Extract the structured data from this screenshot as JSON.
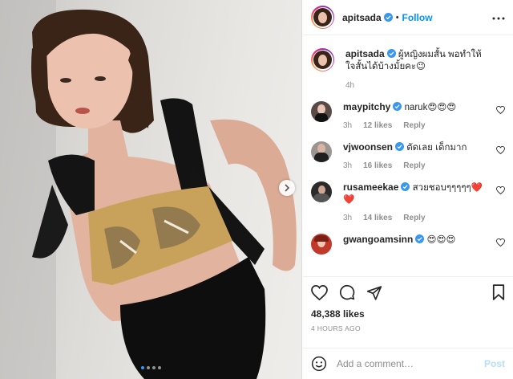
{
  "post": {
    "username": "apitsada",
    "follow_label": "Follow",
    "separator": "•",
    "caption": {
      "username": "apitsada",
      "text": "ผู้หญิงผมสั้น พอทำให้ใจสั้นได้บ้างมั้ยคะ😉",
      "time": "4h"
    },
    "comments": [
      {
        "username": "maypitchy",
        "text": "naruk😍😍😍",
        "time": "3h",
        "likes": "12 likes",
        "reply": "Reply"
      },
      {
        "username": "vjwoonsen",
        "text": "ตัดเลย เด็กมาก",
        "time": "3h",
        "likes": "16 likes",
        "reply": "Reply"
      },
      {
        "username": "rusameekae",
        "text": "สวยชอบๆๆๆๆๆ❤️❤️",
        "time": "3h",
        "likes": "14 likes",
        "reply": "Reply"
      },
      {
        "username": "gwangoamsinn",
        "text": "😍😍😍"
      }
    ],
    "likes_label": "48,388 likes",
    "time_ago": "4 HOURS AGO",
    "comment_placeholder": "Add a comment…",
    "post_label": "Post"
  },
  "carousel": {
    "count": 4,
    "active": 0
  },
  "icons": {
    "verified": "verified-badge-icon",
    "more": "more-options-icon",
    "like": "heart-icon",
    "comment": "comment-icon",
    "share": "share-icon",
    "save": "bookmark-icon",
    "emoji": "emoji-icon",
    "next": "chevron-right-icon"
  },
  "colors": {
    "link_blue": "#0095f6",
    "post_disabled": "#b2dffc",
    "muted_text": "#8e8e8e",
    "verified_blue": "#3897f0"
  }
}
